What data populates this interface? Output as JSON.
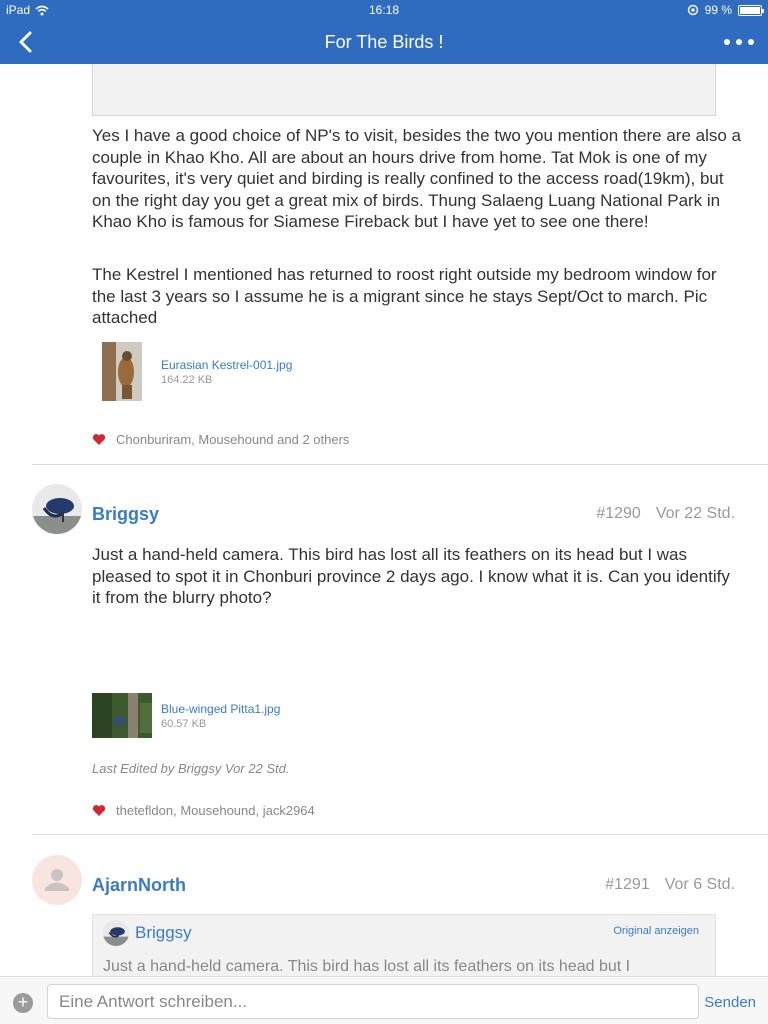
{
  "status_bar": {
    "device": "iPad",
    "time": "16:18",
    "battery": "99 %",
    "battery_level": 0.99
  },
  "nav": {
    "title": "For The Birds !"
  },
  "posts": {
    "p1": {
      "paragraphs": [
        "Yes I have a good choice of NP's to visit, besides the two you mention there are also a couple in Khao Kho. All are about an hours drive from home. Tat Mok is one of my favourites, it's very quiet and birding is really confined to the access road(19km), but on the right day you get a great mix of birds. Thung Salaeng Luang National Park in Khao Kho is famous for Siamese Fireback but I have yet to see one there!",
        "The Kestrel I mentioned has returned to roost right outside my bedroom window for the last 3 years so I assume he is a migrant since he stays Sept/Oct to march. Pic attached"
      ],
      "attachment": {
        "name": "Eurasian Kestrel-001.jpg",
        "size": "164.22 KB"
      },
      "likes": "Chonburiram, Mousehound and 2 others"
    },
    "p2": {
      "author": "Briggsy",
      "number": "#1290",
      "time": "Vor 22 Std.",
      "text": "Just a hand-held camera. This bird has lost all its feathers on its head but I was pleased to spot it in Chonburi province 2 days ago. I know what it is. Can you identify it from the blurry photo?",
      "attachment": {
        "name": "Blue-winged Pitta1.jpg",
        "size": "60.57 KB"
      },
      "edited": "Last Edited by Briggsy Vor 22 Std.",
      "likes": "thetefldon, Mousehound, jack2964"
    },
    "p3": {
      "author": "AjarnNorth",
      "number": "#1291",
      "time": "Vor 6 Std.",
      "quote": {
        "author": "Briggsy",
        "link": "Original anzeigen",
        "text": "Just a hand-held camera. This bird has lost all its feathers on its head but I"
      }
    }
  },
  "reply": {
    "placeholder": "Eine Antwort schreiben...",
    "send": "Senden"
  },
  "colors": {
    "nav": "#2f6bbf",
    "link": "#3a7bc8",
    "heart": "#d0282e"
  }
}
